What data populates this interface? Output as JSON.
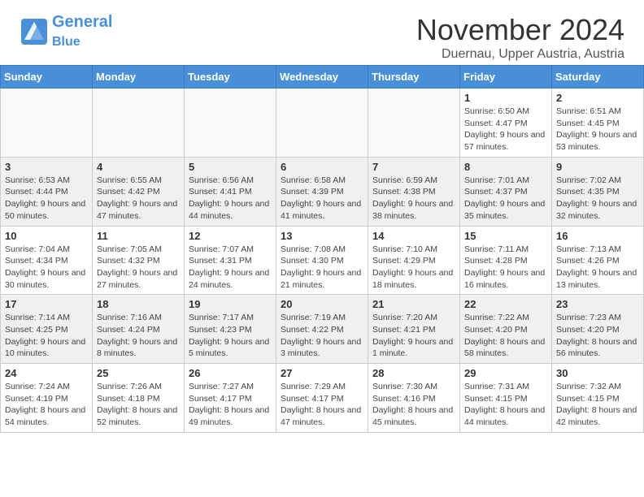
{
  "header": {
    "logo_line1": "General",
    "logo_line2": "Blue",
    "title": "November 2024",
    "subtitle": "Duernau, Upper Austria, Austria"
  },
  "weekdays": [
    "Sunday",
    "Monday",
    "Tuesday",
    "Wednesday",
    "Thursday",
    "Friday",
    "Saturday"
  ],
  "weeks": [
    [
      {
        "day": "",
        "info": ""
      },
      {
        "day": "",
        "info": ""
      },
      {
        "day": "",
        "info": ""
      },
      {
        "day": "",
        "info": ""
      },
      {
        "day": "",
        "info": ""
      },
      {
        "day": "1",
        "info": "Sunrise: 6:50 AM\nSunset: 4:47 PM\nDaylight: 9 hours and 57 minutes."
      },
      {
        "day": "2",
        "info": "Sunrise: 6:51 AM\nSunset: 4:45 PM\nDaylight: 9 hours and 53 minutes."
      }
    ],
    [
      {
        "day": "3",
        "info": "Sunrise: 6:53 AM\nSunset: 4:44 PM\nDaylight: 9 hours and 50 minutes."
      },
      {
        "day": "4",
        "info": "Sunrise: 6:55 AM\nSunset: 4:42 PM\nDaylight: 9 hours and 47 minutes."
      },
      {
        "day": "5",
        "info": "Sunrise: 6:56 AM\nSunset: 4:41 PM\nDaylight: 9 hours and 44 minutes."
      },
      {
        "day": "6",
        "info": "Sunrise: 6:58 AM\nSunset: 4:39 PM\nDaylight: 9 hours and 41 minutes."
      },
      {
        "day": "7",
        "info": "Sunrise: 6:59 AM\nSunset: 4:38 PM\nDaylight: 9 hours and 38 minutes."
      },
      {
        "day": "8",
        "info": "Sunrise: 7:01 AM\nSunset: 4:37 PM\nDaylight: 9 hours and 35 minutes."
      },
      {
        "day": "9",
        "info": "Sunrise: 7:02 AM\nSunset: 4:35 PM\nDaylight: 9 hours and 32 minutes."
      }
    ],
    [
      {
        "day": "10",
        "info": "Sunrise: 7:04 AM\nSunset: 4:34 PM\nDaylight: 9 hours and 30 minutes."
      },
      {
        "day": "11",
        "info": "Sunrise: 7:05 AM\nSunset: 4:32 PM\nDaylight: 9 hours and 27 minutes."
      },
      {
        "day": "12",
        "info": "Sunrise: 7:07 AM\nSunset: 4:31 PM\nDaylight: 9 hours and 24 minutes."
      },
      {
        "day": "13",
        "info": "Sunrise: 7:08 AM\nSunset: 4:30 PM\nDaylight: 9 hours and 21 minutes."
      },
      {
        "day": "14",
        "info": "Sunrise: 7:10 AM\nSunset: 4:29 PM\nDaylight: 9 hours and 18 minutes."
      },
      {
        "day": "15",
        "info": "Sunrise: 7:11 AM\nSunset: 4:28 PM\nDaylight: 9 hours and 16 minutes."
      },
      {
        "day": "16",
        "info": "Sunrise: 7:13 AM\nSunset: 4:26 PM\nDaylight: 9 hours and 13 minutes."
      }
    ],
    [
      {
        "day": "17",
        "info": "Sunrise: 7:14 AM\nSunset: 4:25 PM\nDaylight: 9 hours and 10 minutes."
      },
      {
        "day": "18",
        "info": "Sunrise: 7:16 AM\nSunset: 4:24 PM\nDaylight: 9 hours and 8 minutes."
      },
      {
        "day": "19",
        "info": "Sunrise: 7:17 AM\nSunset: 4:23 PM\nDaylight: 9 hours and 5 minutes."
      },
      {
        "day": "20",
        "info": "Sunrise: 7:19 AM\nSunset: 4:22 PM\nDaylight: 9 hours and 3 minutes."
      },
      {
        "day": "21",
        "info": "Sunrise: 7:20 AM\nSunset: 4:21 PM\nDaylight: 9 hours and 1 minute."
      },
      {
        "day": "22",
        "info": "Sunrise: 7:22 AM\nSunset: 4:20 PM\nDaylight: 8 hours and 58 minutes."
      },
      {
        "day": "23",
        "info": "Sunrise: 7:23 AM\nSunset: 4:20 PM\nDaylight: 8 hours and 56 minutes."
      }
    ],
    [
      {
        "day": "24",
        "info": "Sunrise: 7:24 AM\nSunset: 4:19 PM\nDaylight: 8 hours and 54 minutes."
      },
      {
        "day": "25",
        "info": "Sunrise: 7:26 AM\nSunset: 4:18 PM\nDaylight: 8 hours and 52 minutes."
      },
      {
        "day": "26",
        "info": "Sunrise: 7:27 AM\nSunset: 4:17 PM\nDaylight: 8 hours and 49 minutes."
      },
      {
        "day": "27",
        "info": "Sunrise: 7:29 AM\nSunset: 4:17 PM\nDaylight: 8 hours and 47 minutes."
      },
      {
        "day": "28",
        "info": "Sunrise: 7:30 AM\nSunset: 4:16 PM\nDaylight: 8 hours and 45 minutes."
      },
      {
        "day": "29",
        "info": "Sunrise: 7:31 AM\nSunset: 4:15 PM\nDaylight: 8 hours and 44 minutes."
      },
      {
        "day": "30",
        "info": "Sunrise: 7:32 AM\nSunset: 4:15 PM\nDaylight: 8 hours and 42 minutes."
      }
    ]
  ]
}
